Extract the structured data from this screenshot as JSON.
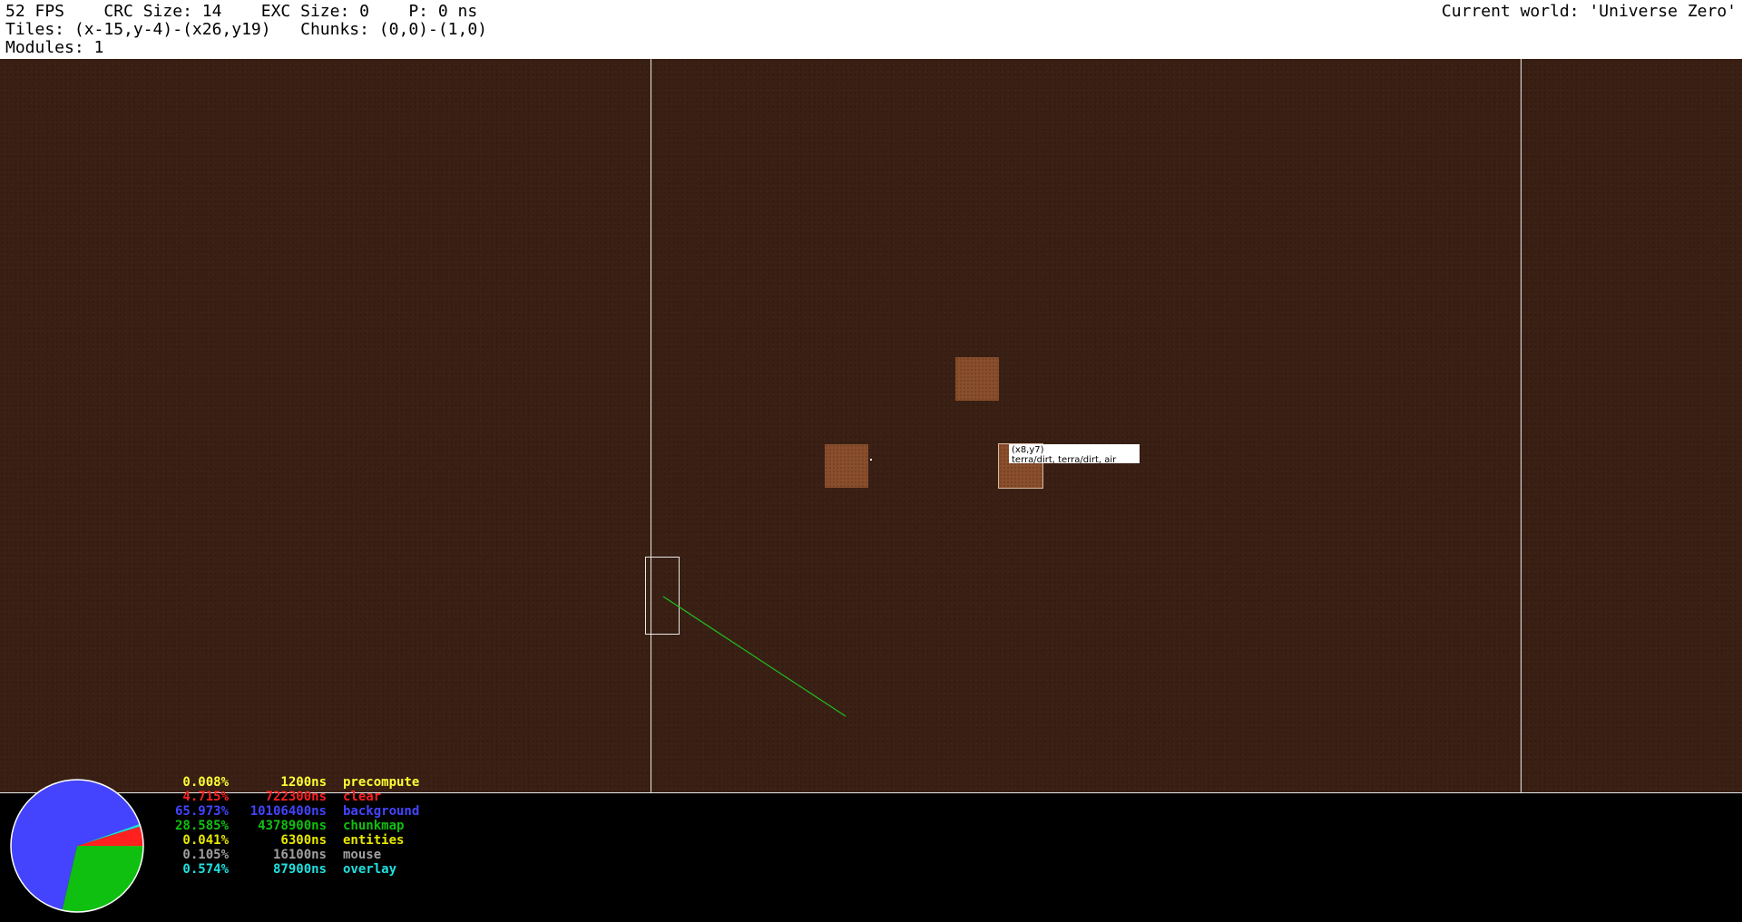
{
  "hud": {
    "line1": "52 FPS    CRC Size: 14    EXC Size: 0    P: 0 ns",
    "line2": "Tiles: (x-15,y-4)-(x26,y19)   Chunks: (0,0)-(1,0)",
    "line3": "Modules: 1",
    "world": "Current world: 'Universe Zero'"
  },
  "tooltip": {
    "coords": "(x8,y7)",
    "layers": "terra/dirt, terra/dirt, air"
  },
  "profiler": {
    "rows": [
      {
        "percent": "0.008%",
        "ns": "1200ns",
        "label": "precompute",
        "color": "#ffff33",
        "value": 0.008
      },
      {
        "percent": "4.715%",
        "ns": "722300ns",
        "label": "clear",
        "color": "#ff2020",
        "value": 4.715
      },
      {
        "percent": "65.973%",
        "ns": "10106400ns",
        "label": "background",
        "color": "#4444ff",
        "value": 65.973
      },
      {
        "percent": "28.585%",
        "ns": "4378900ns",
        "label": "chunkmap",
        "color": "#10c010",
        "value": 28.585
      },
      {
        "percent": "0.041%",
        "ns": "6300ns",
        "label": "entities",
        "color": "#e8e800",
        "value": 0.041
      },
      {
        "percent": "0.105%",
        "ns": "16100ns",
        "label": "mouse",
        "color": "#a0a0a0",
        "value": 0.105
      },
      {
        "percent": "0.574%",
        "ns": "87900ns",
        "label": "overlay",
        "color": "#20e0e0",
        "value": 0.574
      }
    ]
  }
}
